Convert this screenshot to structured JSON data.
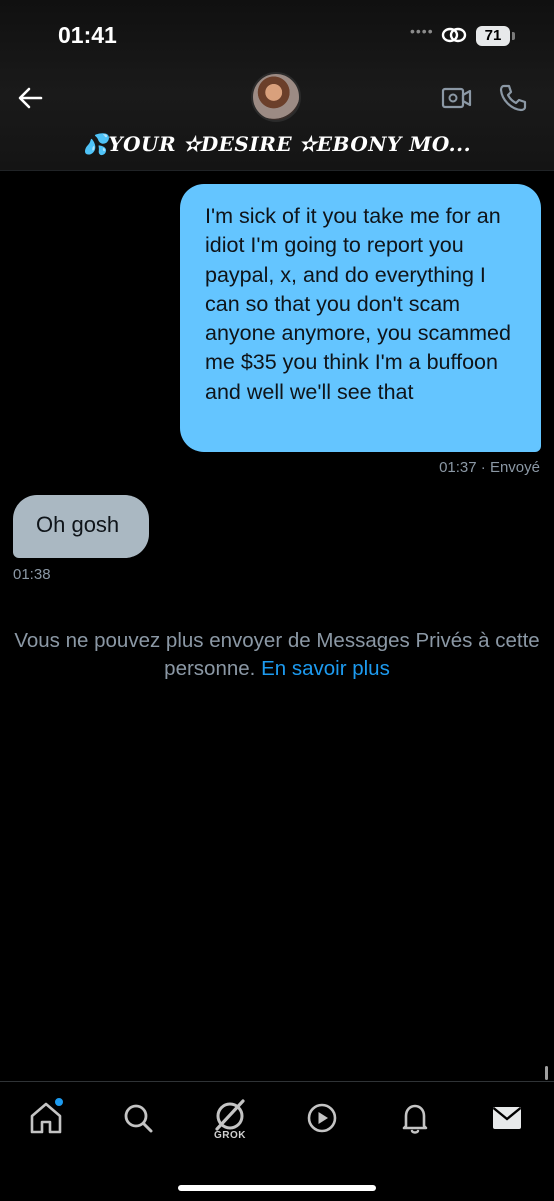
{
  "status_bar": {
    "time": "01:41",
    "signal": "••••",
    "battery": "71"
  },
  "header": {
    "contact_name": "💦YOUR ✫DESIRE ✫EBONY MO..."
  },
  "messages": [
    {
      "direction": "sent",
      "text": "I'm sick of it you take me for an idiot I'm going to report you paypal, x, and do everything I can so that you don't scam anyone anymore, you scammed me $35 you think I'm a buffoon and well we'll see that",
      "time": "01:37",
      "status": "· Envoyé"
    },
    {
      "direction": "received",
      "text": "Oh gosh",
      "time": "01:38"
    }
  ],
  "notice": {
    "text": "Vous ne pouvez plus envoyer de Messages Privés à cette personne.",
    "link": "En savoir plus"
  },
  "bottom_nav": {
    "items": [
      {
        "id": "home",
        "icon": "home-icon"
      },
      {
        "id": "search",
        "icon": "search-icon"
      },
      {
        "id": "grok",
        "icon": "grok-icon",
        "label": "GROK"
      },
      {
        "id": "video",
        "icon": "play-circle-icon"
      },
      {
        "id": "notifications",
        "icon": "bell-icon"
      },
      {
        "id": "messages",
        "icon": "envelope-icon"
      }
    ]
  },
  "colors": {
    "sent_bubble": "#64c5ff",
    "received_bubble": "#aab8c2",
    "link": "#1d9bf0",
    "muted": "#8b98a5"
  }
}
